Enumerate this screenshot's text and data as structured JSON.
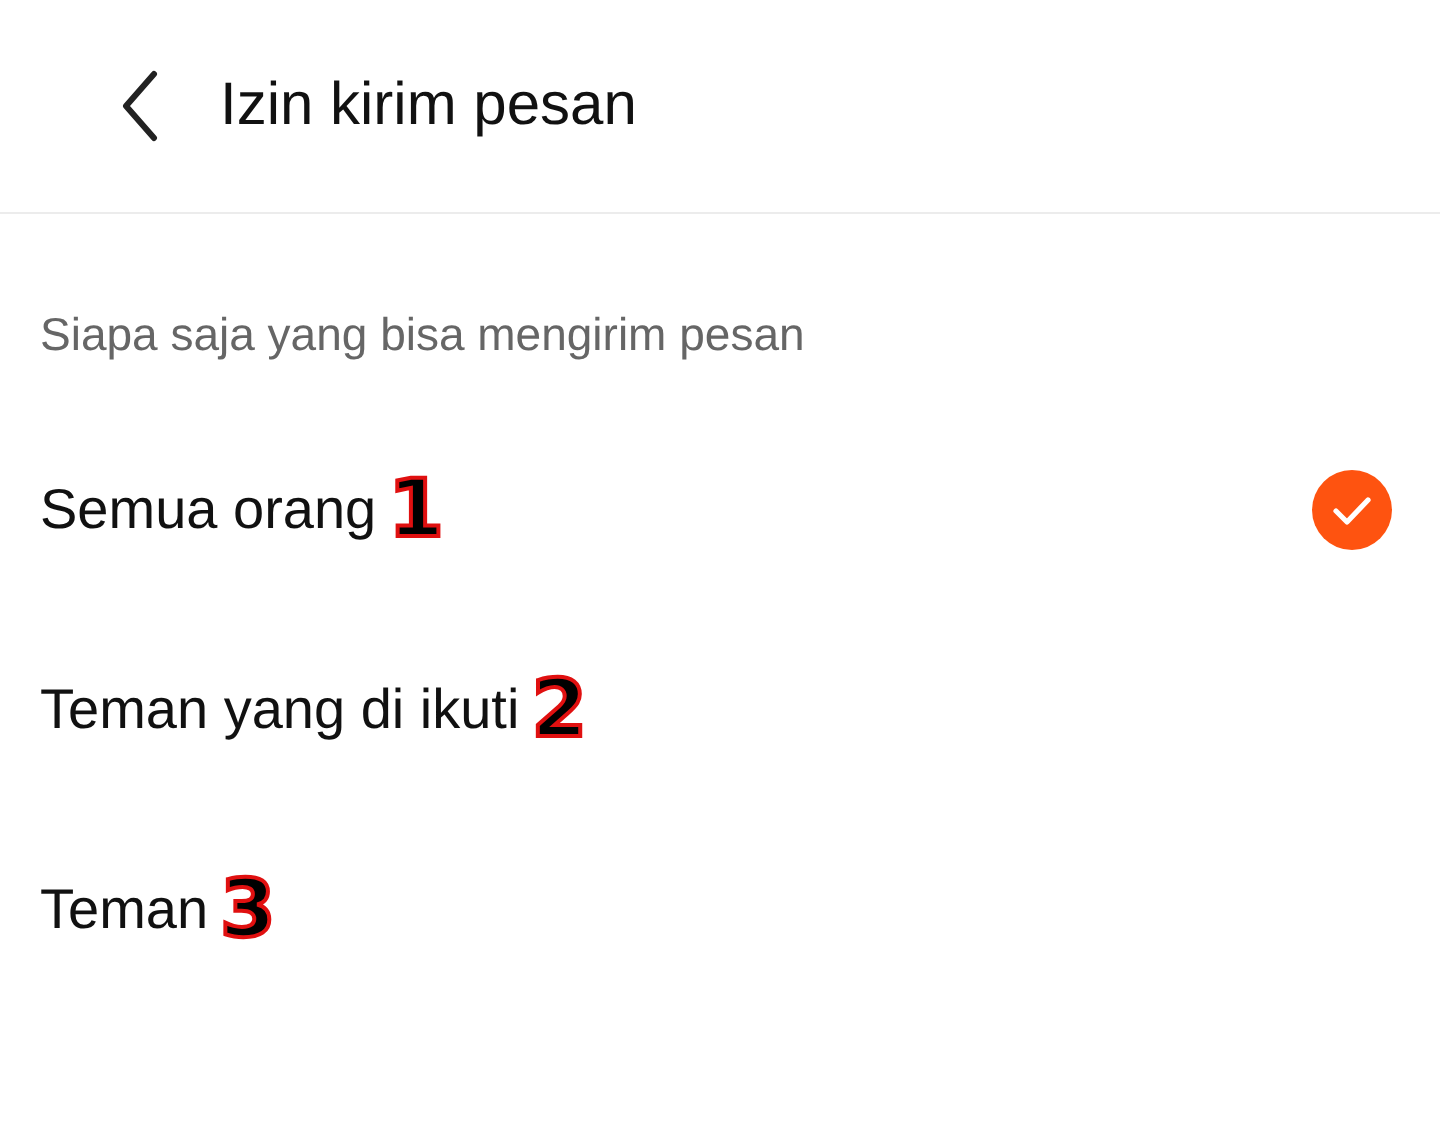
{
  "header": {
    "title": "Izin kirim pesan"
  },
  "section_label": "Siapa saja yang bisa mengirim pesan",
  "options": [
    {
      "label": "Semua orang",
      "marker": "1",
      "selected": true
    },
    {
      "label": "Teman yang di ikuti",
      "marker": "2",
      "selected": false
    },
    {
      "label": "Teman",
      "marker": "3",
      "selected": false
    }
  ]
}
